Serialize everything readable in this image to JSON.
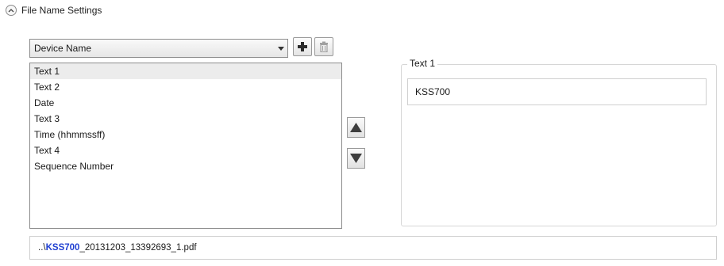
{
  "section": {
    "title": "File Name Settings",
    "toggle_icon": "chevron-up-icon"
  },
  "dropdown": {
    "selected": "Device Name",
    "caret_icon": "caret-down-icon"
  },
  "toolbar": {
    "add_icon": "plus-icon",
    "delete_icon": "trash-icon"
  },
  "fields": {
    "items": [
      "Text 1",
      "Text 2",
      "Date",
      "Text 3",
      "Time (hhmmssff)",
      "Text 4",
      "Sequence Number"
    ],
    "selected_index": 0
  },
  "move": {
    "up_icon": "arrow-up-icon",
    "down_icon": "arrow-down-icon"
  },
  "editor": {
    "label": "Text 1",
    "value": "KSS700"
  },
  "preview": {
    "prefix": "..\\",
    "highlight": "KSS700",
    "rest": "_20131203_13392693_1.pdf",
    "highlight_color": "#1f3fd1"
  },
  "colors": {
    "selection": "#ececec",
    "border": "#8c8c8c"
  }
}
